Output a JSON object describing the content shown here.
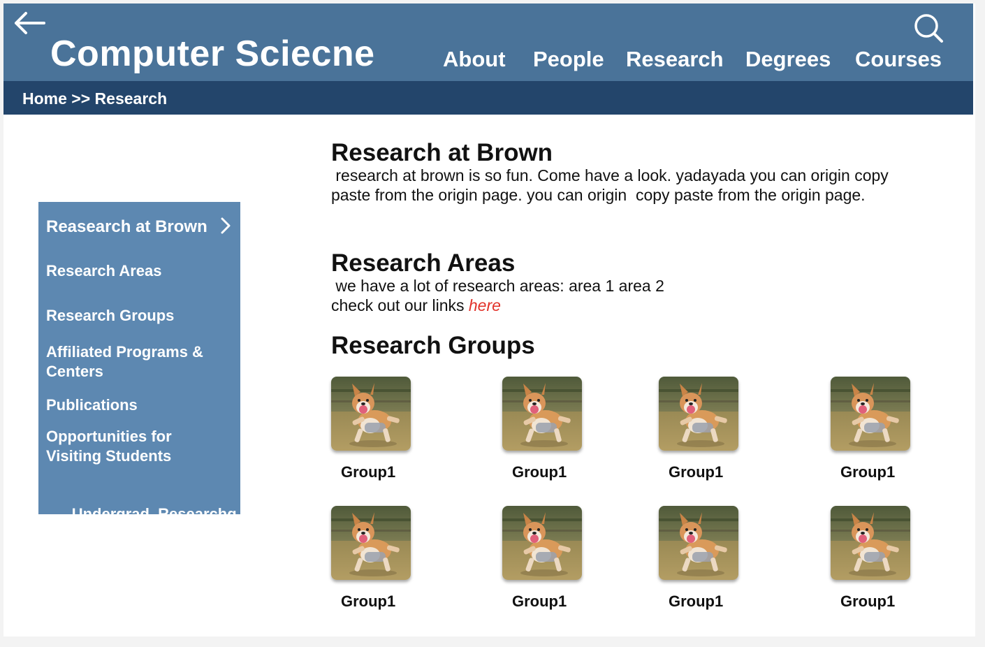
{
  "header": {
    "title": "Computer Sciecne",
    "back_icon": "arrow-left-icon",
    "search_icon": "search-icon",
    "nav": [
      "About",
      "People",
      "Research",
      "Degrees",
      "Courses"
    ]
  },
  "breadcrumb": "Home >> Research",
  "sidebar": {
    "items": [
      "Reasearch at Brown",
      "Research Areas",
      "Research Groups",
      "Affiliated Programs & Centers",
      "Publications",
      "Opportunities for Visiting Students",
      "Undergrad  Researchg"
    ],
    "active_icon": "chevron-right-icon"
  },
  "sections": {
    "brown": {
      "heading": "Research at Brown",
      "text": " research at brown is so fun. Come have a look. yadayada you can origin copy paste from the origin page. you can origin  copy paste from the origin page."
    },
    "areas": {
      "heading": "Research Areas",
      "line1": " we have a lot of research areas: area 1 area 2",
      "line2_prefix": "check out our links ",
      "link": "here"
    },
    "groups": {
      "heading": "Research Groups",
      "items": [
        "Group1",
        "Group1",
        "Group1",
        "Group1",
        "Group1",
        "Group1",
        "Group1",
        "Group1"
      ]
    }
  },
  "colors": {
    "header_bg": "#4a7399",
    "breadcrumb_bg": "#23456b",
    "sidebar_bg": "#5d88b1",
    "link": "#e2332b"
  }
}
